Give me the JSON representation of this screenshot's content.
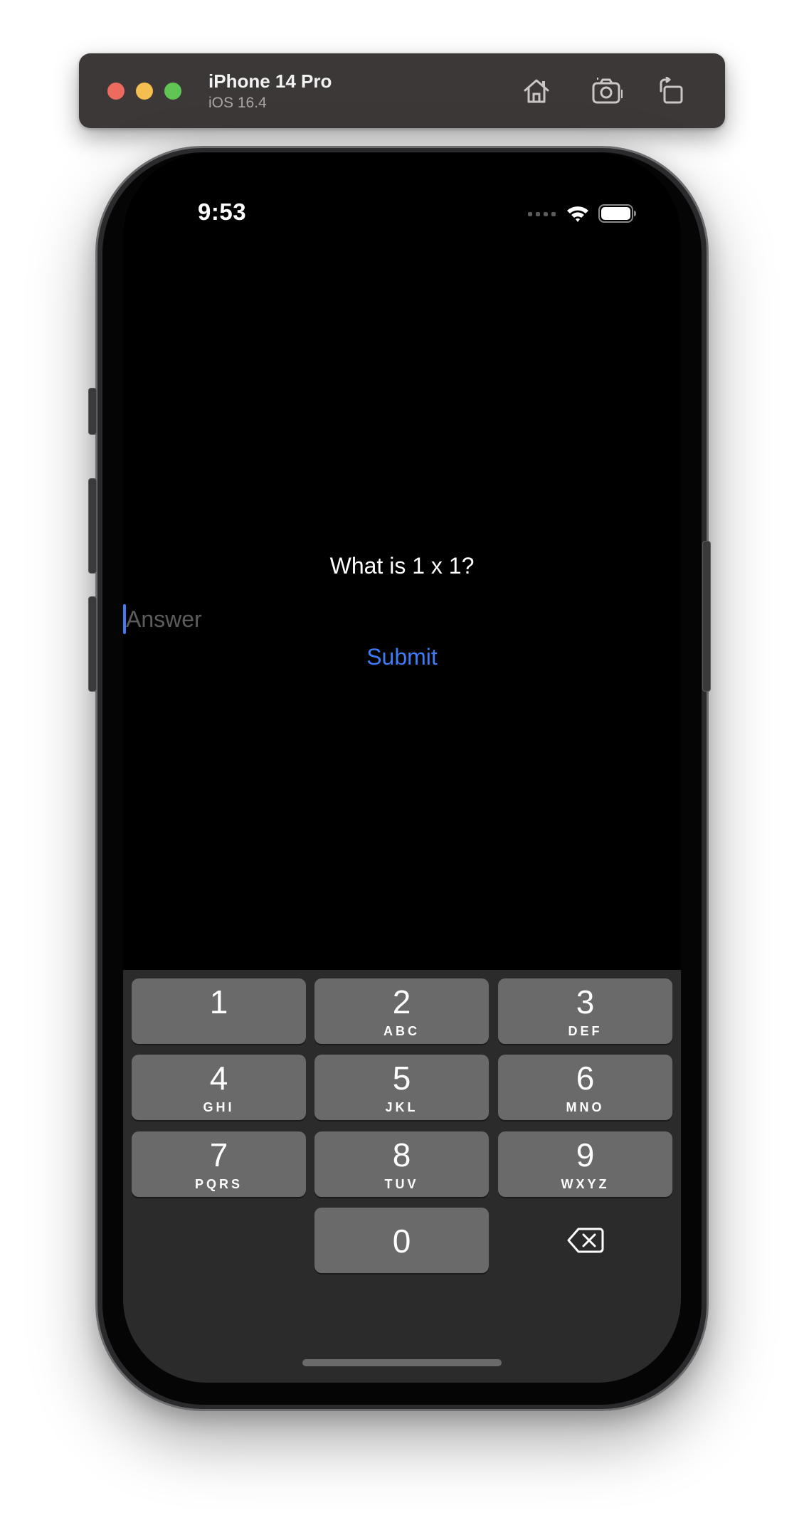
{
  "simulator": {
    "device_name": "iPhone 14 Pro",
    "os_version": "iOS 16.4",
    "buttons": [
      "home-icon",
      "screenshot-icon",
      "rotate-icon"
    ]
  },
  "status_bar": {
    "time": "9:53",
    "icons": [
      "cellular-icon",
      "wifi-icon",
      "battery-icon"
    ]
  },
  "content": {
    "question": "What is 1 x 1?",
    "answer": {
      "value": "",
      "placeholder": "Answer"
    },
    "submit_label": "Submit"
  },
  "keyboard": {
    "keys": [
      {
        "digit": "1",
        "letters": ""
      },
      {
        "digit": "2",
        "letters": "ABC"
      },
      {
        "digit": "3",
        "letters": "DEF"
      },
      {
        "digit": "4",
        "letters": "GHI"
      },
      {
        "digit": "5",
        "letters": "JKL"
      },
      {
        "digit": "6",
        "letters": "MNO"
      },
      {
        "digit": "7",
        "letters": "PQRS"
      },
      {
        "digit": "8",
        "letters": "TUV"
      },
      {
        "digit": "9",
        "letters": "WXYZ"
      },
      {
        "digit": "0",
        "letters": ""
      }
    ],
    "delete_icon": "backspace-icon"
  },
  "colors": {
    "accent": "#3d7cf5",
    "key_background": "#6a6a6a",
    "keyboard_background": "#2b2b2b",
    "screen_background": "#000000",
    "toolbar_background": "#3b3837"
  }
}
